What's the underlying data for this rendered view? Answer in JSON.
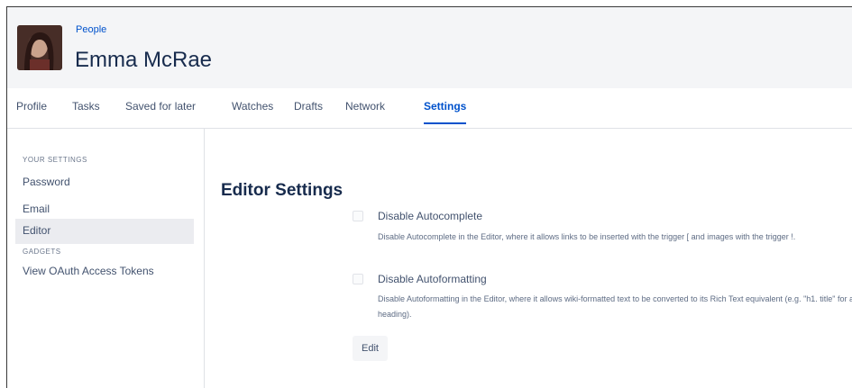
{
  "header": {
    "breadcrumb": "People",
    "name": "Emma McRae"
  },
  "tabs": [
    {
      "label": "Profile"
    },
    {
      "label": "Tasks"
    },
    {
      "label": "Saved for later"
    },
    {
      "label": "Watches"
    },
    {
      "label": "Drafts"
    },
    {
      "label": "Network"
    },
    {
      "label": "Settings",
      "active": true
    }
  ],
  "sidebar": {
    "your_settings_heading": "YOUR SETTINGS",
    "items": [
      {
        "label": "Password"
      },
      {
        "label": "Email"
      },
      {
        "label": "Editor",
        "active": true
      }
    ],
    "gadgets_heading": "GADGETS",
    "oauth_label": "View OAuth Access Tokens"
  },
  "main": {
    "title": "Editor Settings",
    "options": [
      {
        "label": "Disable Autocomplete",
        "description": "Disable Autocomplete in the Editor, where it allows links to be inserted with the trigger [ and images with the trigger !.",
        "checked": false
      },
      {
        "label": "Disable Autoformatting",
        "description": "Disable Autoformatting in the Editor, where it allows wiki-formatted text to be converted to its Rich Text equivalent (e.g. \"h1. title\" for a heading).",
        "checked": false
      }
    ],
    "edit_label": "Edit"
  },
  "colors": {
    "link": "#0052cc",
    "active_nav_bg": "#ebecf0",
    "header_bg": "#f4f5f7"
  }
}
